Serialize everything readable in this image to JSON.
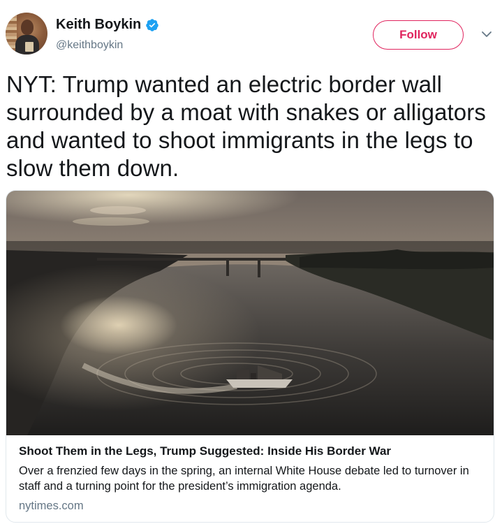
{
  "user": {
    "display_name": "Keith Boykin",
    "handle": "@keithboykin",
    "verified": true,
    "verified_icon": "verified-badge-icon",
    "verified_color": "#1da1f2"
  },
  "actions": {
    "follow_label": "Follow",
    "follow_color": "#e0245e",
    "more_icon": "chevron-down-icon"
  },
  "tweet": {
    "text": "NYT: Trump wanted an electric border wall surrounded by a moat with snakes or alligators and wanted to shoot immigrants in the legs to slow them down."
  },
  "card": {
    "image_description_icon": "river-border-photo",
    "title": "Shoot Them in the Legs, Trump Suggested: Inside His Border War",
    "description": "Over a frenzied few days in the spring, an internal White House debate led to turnover in staff and a turning point for the president’s immigration agenda.",
    "domain": "nytimes.com"
  }
}
